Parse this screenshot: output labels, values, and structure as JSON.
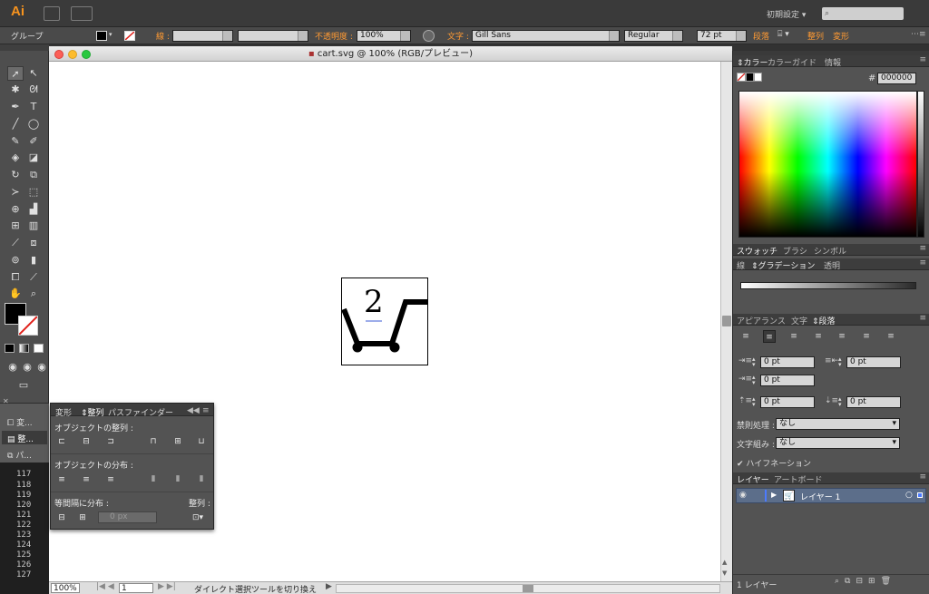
{
  "app": {
    "logo": "Ai",
    "workspace": "初期設定"
  },
  "control_bar": {
    "selection_type": "グループ",
    "stroke_label": "線 :",
    "opacity_label": "不透明度 :",
    "opacity_value": "100%",
    "char_label": "文字 :",
    "font_family": "Gill Sans",
    "font_style": "Regular",
    "font_size": "72 pt",
    "paragraph_link": "段落",
    "align_link": "整列",
    "transform_link": "変形"
  },
  "document": {
    "title": "cart.svg @ 100% (RGB/プレビュー)",
    "artwork_number": "2",
    "zoom": "100%",
    "page": "1",
    "status_text": "ダイレクト選択ツールを切り換え"
  },
  "align_panel": {
    "tabs": [
      "変形",
      "整列",
      "パスファインダー"
    ],
    "align_objects_label": "オブジェクトの整列 :",
    "distribute_objects_label": "オブジェクトの分布 :",
    "distribute_spacing_label": "等間隔に分布 :",
    "align_to_label": "整列 :",
    "spacing_value": "0 px"
  },
  "mini_panels": [
    "変...",
    "整...",
    "パ..."
  ],
  "line_numbers": [
    "117",
    "118",
    "119",
    "120",
    "121",
    "122",
    "123",
    "124",
    "125",
    "126",
    "127"
  ],
  "color_panel": {
    "tabs": [
      "カラー",
      "カラーガイド",
      "情報"
    ],
    "hex_label": "#",
    "hex_value": "000000"
  },
  "swatch_tabs": [
    "スウォッチ",
    "ブラシ",
    "シンボル"
  ],
  "gradient_tabs": [
    "線",
    "グラデーション",
    "透明"
  ],
  "paragraph_panel": {
    "tabs": [
      "アピアランス",
      "文字",
      "段落"
    ],
    "left_indent": "0 pt",
    "right_indent": "0 pt",
    "first_line_indent": "0 pt",
    "space_before": "0 pt",
    "space_after": "0 pt",
    "kinsoku_label": "禁則処理 :",
    "kinsoku_value": "なし",
    "mojikumi_label": "文字組み :",
    "mojikumi_value": "なし",
    "hyphenation_label": "ハイフネーション"
  },
  "layers_panel": {
    "tabs": [
      "レイヤー",
      "アートボード"
    ],
    "layer_name": "レイヤー 1",
    "footer": "1 レイヤー"
  },
  "colors": {
    "accent_orange": "#ff9a33",
    "layer_selected": "#5c6e8a"
  }
}
